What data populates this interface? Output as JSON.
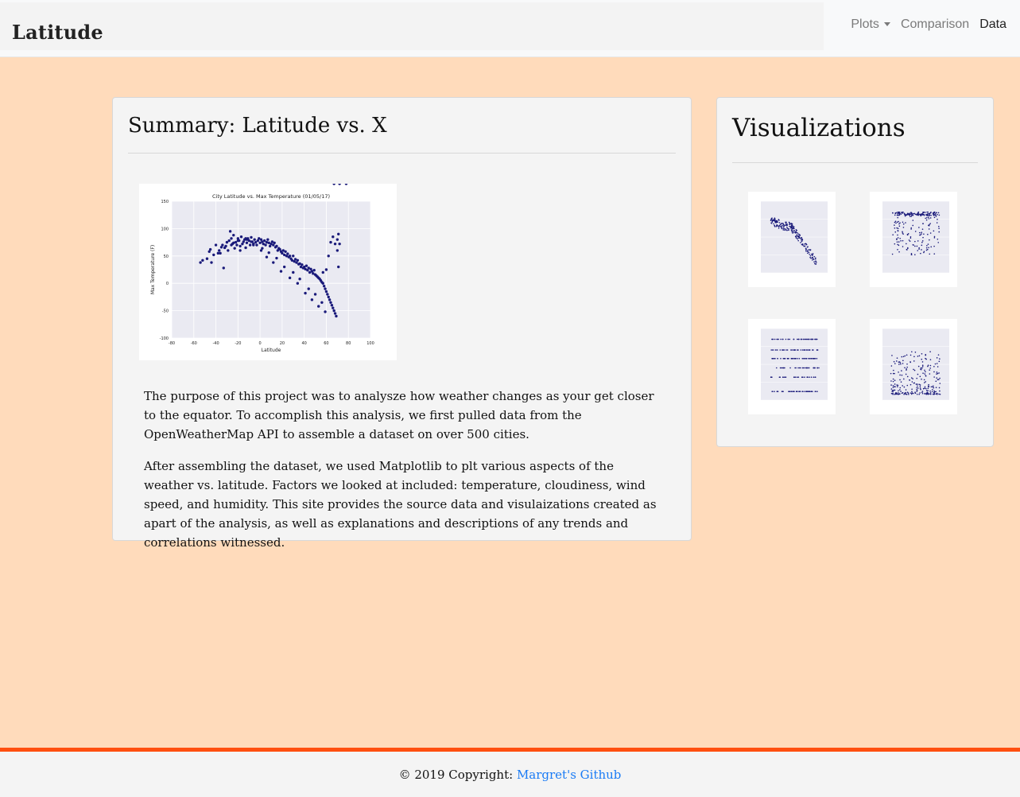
{
  "navbar": {
    "brand": "Latitude",
    "links": [
      {
        "label": "Plots",
        "dropdown": true
      },
      {
        "label": "Comparison"
      },
      {
        "label": "Data"
      }
    ]
  },
  "summary": {
    "title": "Summary: Latitude vs. X",
    "paragraphs": [
      "The purpose of this project was to analysze how weather changes as your get closer to the equator. To accomplish this analysis, we first pulled data from the OpenWeatherMap API to assemble a dataset on over 500 cities.",
      "After assembling the dataset, we used Matplotlib to plt various aspects of the weather vs. latitude. Factors we looked at included: temperature, cloudiness, wind speed, and humidity. This site provides the source data and visulaizations created as apart of the analysis, as well as explanations and descriptions of any trends and correlations witnessed."
    ]
  },
  "visualizations": {
    "title": "Visualizations"
  },
  "chart_data": {
    "type": "scatter",
    "title": "City Latitude vs. Max Temperature (01/05/17)",
    "xlabel": "Latitude",
    "ylabel": "Max Temperature (F)",
    "xlim": [
      -80,
      100
    ],
    "ylim": [
      -100,
      150
    ],
    "xticks": [
      -80,
      -60,
      -40,
      -20,
      0,
      20,
      40,
      60,
      80,
      100
    ],
    "yticks": [
      -100,
      -50,
      0,
      50,
      100,
      150
    ],
    "grid": true,
    "point_color": "#1a1a7a",
    "background_color": "#eaeaf2",
    "x": [
      -54,
      -52,
      -48,
      -46,
      -45,
      -44,
      -42,
      -40,
      -38,
      -37,
      -35,
      -34,
      -33,
      -32,
      -30,
      -29,
      -28,
      -27,
      -26,
      -25,
      -24,
      -23,
      -22,
      -21,
      -20,
      -19,
      -18,
      -17,
      -16,
      -15,
      -14,
      -13,
      -12,
      -11,
      -10,
      -9,
      -8,
      -7,
      -6,
      -5,
      -4,
      -3,
      -2,
      -1,
      0,
      1,
      2,
      3,
      4,
      5,
      6,
      7,
      8,
      9,
      10,
      11,
      12,
      13,
      14,
      15,
      16,
      17,
      18,
      19,
      20,
      21,
      22,
      23,
      24,
      25,
      26,
      27,
      28,
      29,
      30,
      31,
      32,
      33,
      34,
      35,
      36,
      37,
      38,
      39,
      40,
      41,
      42,
      43,
      44,
      45,
      46,
      47,
      48,
      49,
      50,
      51,
      52,
      53,
      54,
      55,
      56,
      57,
      58,
      59,
      60,
      61,
      62,
      63,
      64,
      65,
      66,
      67,
      68,
      69,
      70,
      71,
      72,
      -31,
      -24,
      -18,
      -12,
      -6,
      2,
      8,
      15,
      22,
      30,
      36,
      44,
      50,
      56,
      62,
      66,
      70,
      -36,
      -26,
      -20,
      -13,
      -8,
      1,
      6,
      12,
      19,
      27,
      34,
      41,
      47,
      53,
      59,
      64,
      68,
      71,
      57,
      60,
      67,
      72,
      78
    ],
    "y": [
      38,
      42,
      45,
      58,
      62,
      38,
      52,
      70,
      55,
      60,
      66,
      70,
      28,
      65,
      75,
      60,
      78,
      95,
      82,
      72,
      88,
      64,
      75,
      70,
      82,
      78,
      68,
      85,
      72,
      76,
      80,
      65,
      74,
      82,
      78,
      70,
      84,
      76,
      72,
      80,
      75,
      70,
      78,
      82,
      74,
      80,
      76,
      72,
      78,
      70,
      75,
      80,
      74,
      68,
      72,
      76,
      70,
      74,
      66,
      68,
      60,
      64,
      62,
      58,
      55,
      60,
      52,
      58,
      50,
      54,
      48,
      50,
      45,
      42,
      50,
      40,
      44,
      38,
      42,
      35,
      36,
      30,
      34,
      28,
      30,
      26,
      32,
      24,
      28,
      20,
      26,
      22,
      18,
      24,
      16,
      14,
      12,
      10,
      8,
      5,
      2,
      0,
      -5,
      -10,
      -15,
      -20,
      -25,
      -30,
      -35,
      -40,
      -45,
      -50,
      -55,
      -60,
      80,
      90,
      72,
      68,
      74,
      60,
      80,
      70,
      64,
      56,
      46,
      30,
      20,
      8,
      -10,
      -20,
      -35,
      50,
      85,
      60,
      55,
      70,
      78,
      82,
      76,
      60,
      48,
      38,
      22,
      10,
      0,
      -18,
      -30,
      -42,
      -52,
      75,
      72,
      30,
      20,
      25
    ]
  }
}
